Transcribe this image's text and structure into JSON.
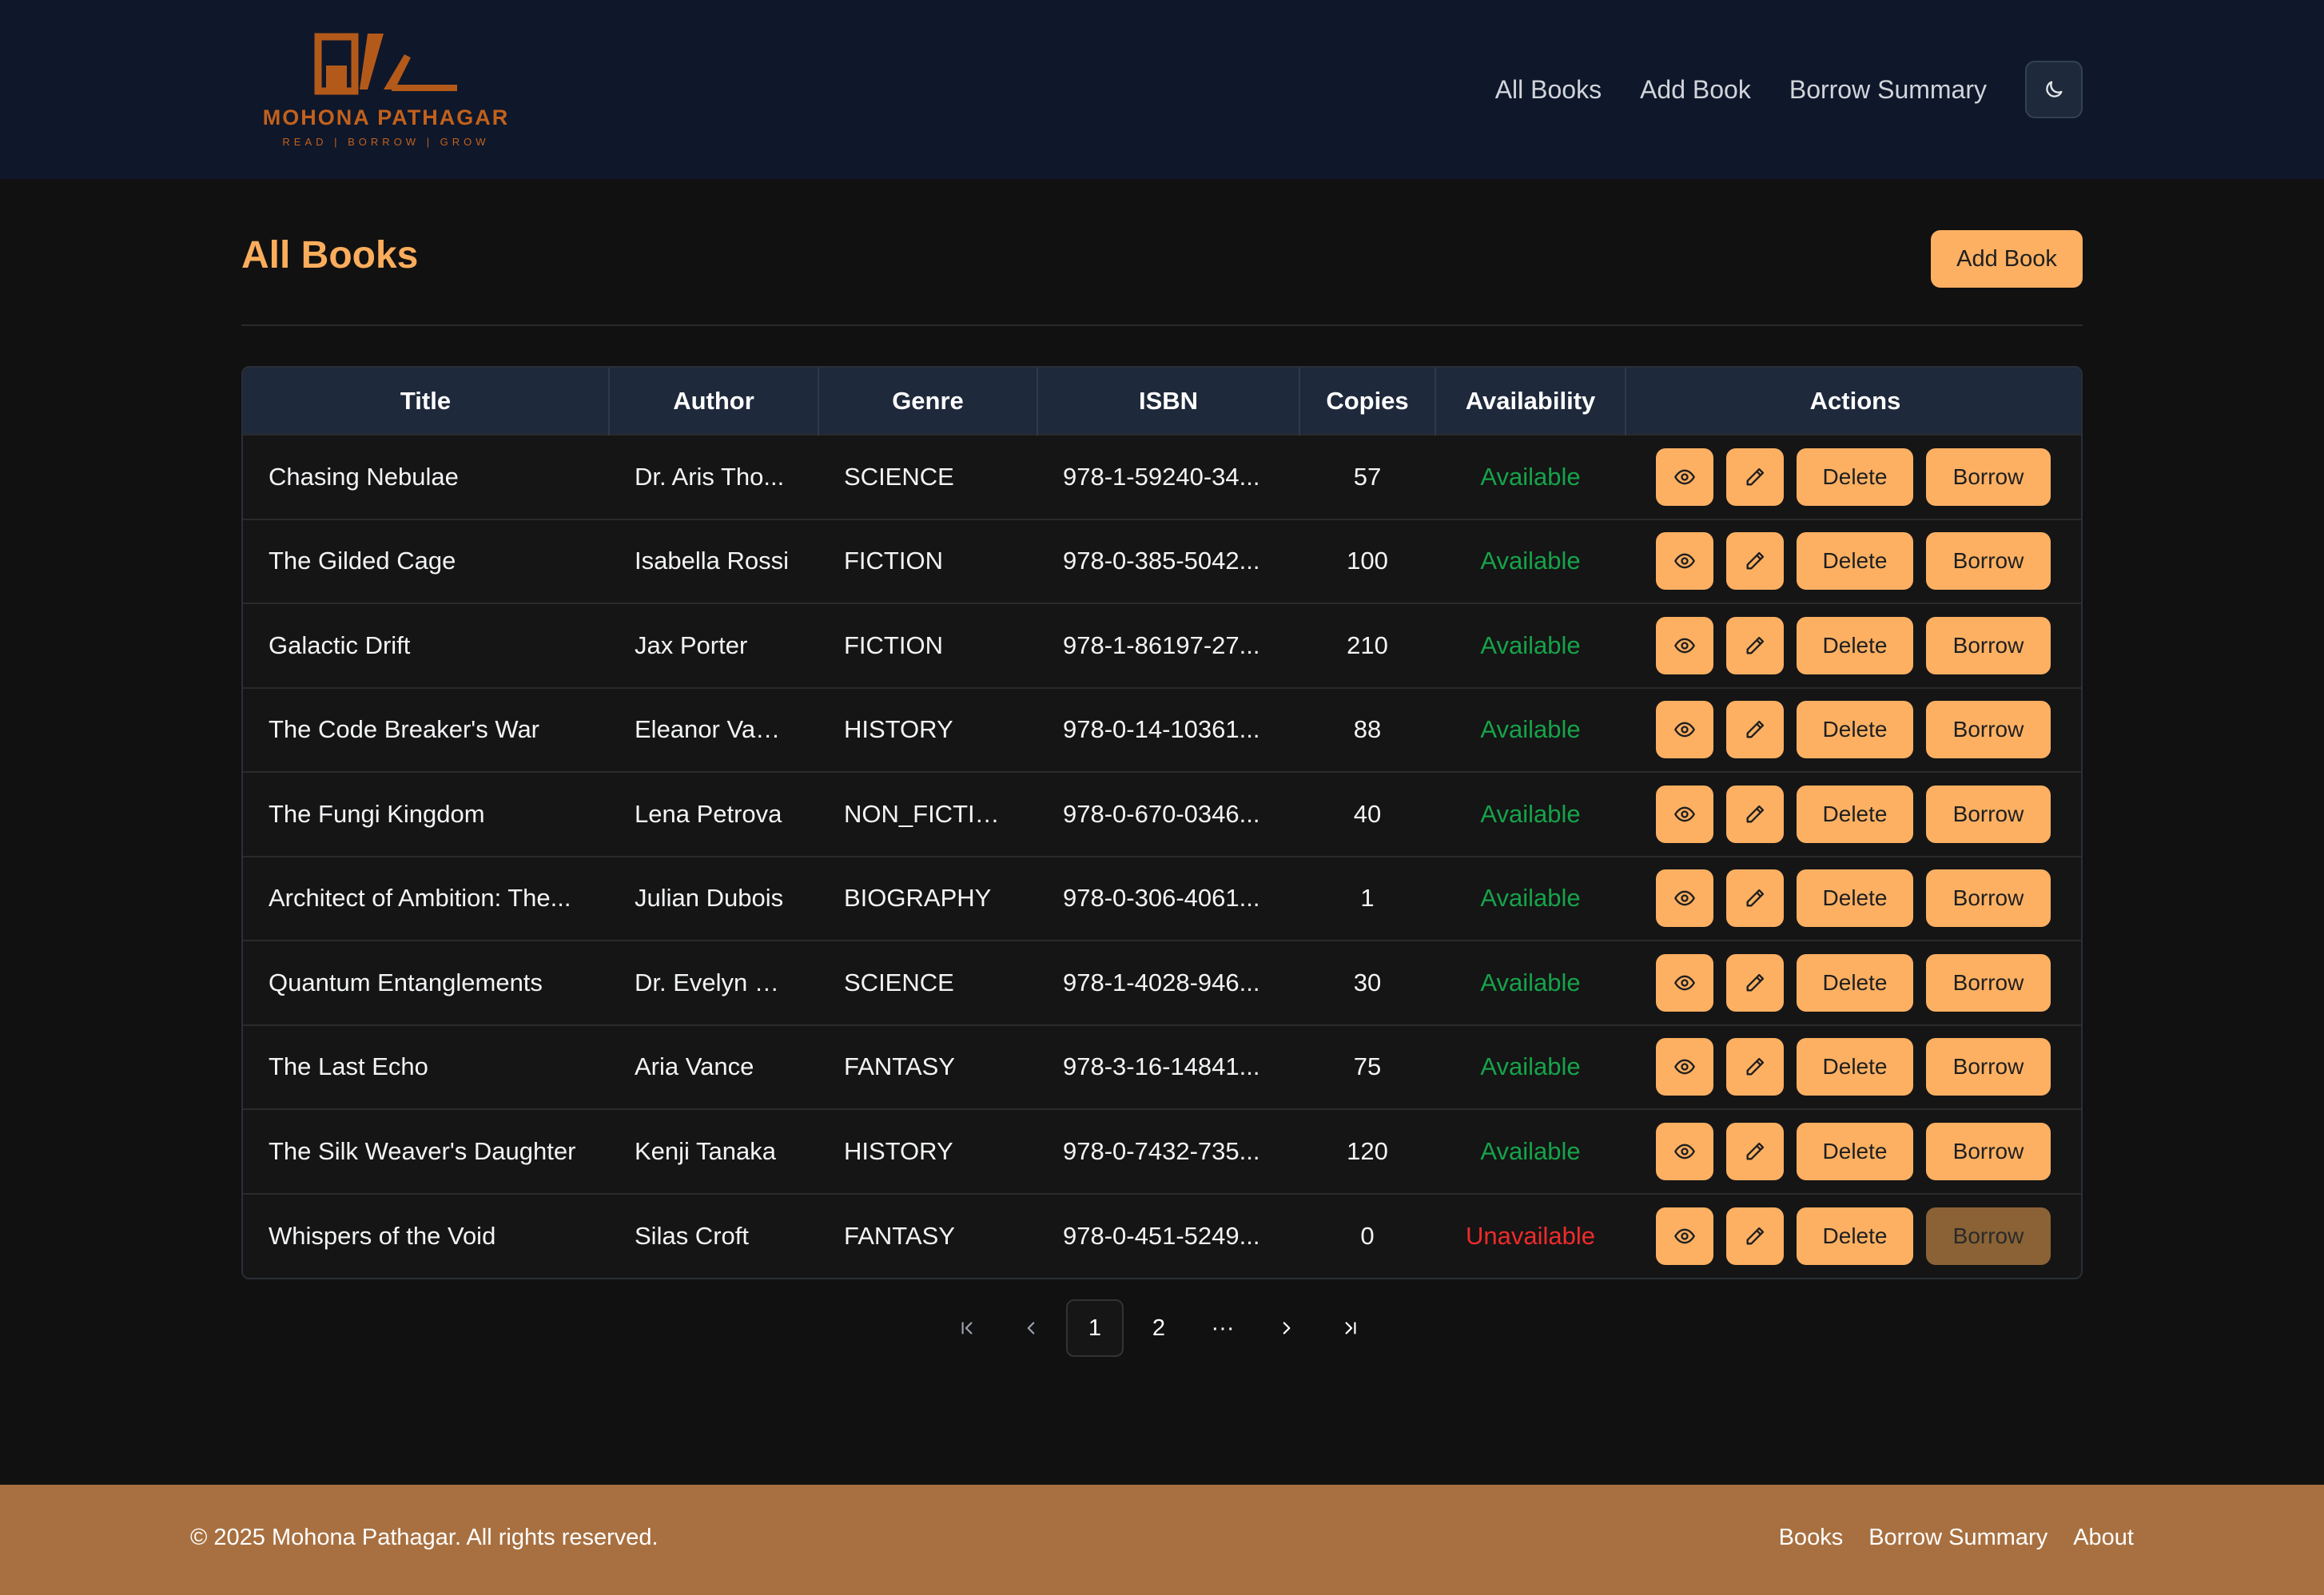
{
  "brand": {
    "name": "MOHONA PATHAGAR",
    "tagline": "READ | BORROW | GROW",
    "accent": "#c2611c"
  },
  "nav": {
    "items": [
      "All Books",
      "Add Book",
      "Borrow Summary"
    ],
    "theme_toggle_icon": "moon-icon"
  },
  "page": {
    "title": "All Books",
    "add_button": "Add Book"
  },
  "table": {
    "columns": [
      "Title",
      "Author",
      "Genre",
      "ISBN",
      "Copies",
      "Availability",
      "Actions"
    ],
    "rows": [
      {
        "title": "Chasing Nebulae",
        "author": "Dr. Aris Tho...",
        "genre": "SCIENCE",
        "isbn": "978-1-59240-34...",
        "copies": "57",
        "availability": "Available",
        "borrow_enabled": true
      },
      {
        "title": "The Gilded Cage",
        "author": "Isabella Rossi",
        "genre": "FICTION",
        "isbn": "978-0-385-5042...",
        "copies": "100",
        "availability": "Available",
        "borrow_enabled": true
      },
      {
        "title": "Galactic Drift",
        "author": "Jax Porter",
        "genre": "FICTION",
        "isbn": "978-1-86197-27...",
        "copies": "210",
        "availability": "Available",
        "borrow_enabled": true
      },
      {
        "title": "The Code Breaker's War",
        "author": "Eleanor Vance",
        "genre": "HISTORY",
        "isbn": "978-0-14-10361...",
        "copies": "88",
        "availability": "Available",
        "borrow_enabled": true
      },
      {
        "title": "The Fungi Kingdom",
        "author": "Lena Petrova",
        "genre": "NON_FICTION",
        "isbn": "978-0-670-0346...",
        "copies": "40",
        "availability": "Available",
        "borrow_enabled": true
      },
      {
        "title": "Architect of Ambition: The...",
        "author": "Julian Dubois",
        "genre": "BIOGRAPHY",
        "isbn": "978-0-306-4061...",
        "copies": "1",
        "availability": "Available",
        "borrow_enabled": true
      },
      {
        "title": "Quantum Entanglements",
        "author": "Dr. Evelyn R...",
        "genre": "SCIENCE",
        "isbn": "978-1-4028-946...",
        "copies": "30",
        "availability": "Available",
        "borrow_enabled": true
      },
      {
        "title": "The Last Echo",
        "author": "Aria Vance",
        "genre": "FANTASY",
        "isbn": "978-3-16-14841...",
        "copies": "75",
        "availability": "Available",
        "borrow_enabled": true
      },
      {
        "title": "The Silk Weaver's Daughter",
        "author": "Kenji Tanaka",
        "genre": "HISTORY",
        "isbn": "978-0-7432-735...",
        "copies": "120",
        "availability": "Available",
        "borrow_enabled": true
      },
      {
        "title": "Whispers of the Void",
        "author": "Silas Croft",
        "genre": "FANTASY",
        "isbn": "978-0-451-5249...",
        "copies": "0",
        "availability": "Unavailable",
        "borrow_enabled": false
      }
    ],
    "row_actions": {
      "view_icon": "eye-icon",
      "edit_icon": "pencil-icon",
      "delete_label": "Delete",
      "borrow_label": "Borrow"
    },
    "colors": {
      "available": "#16a34a",
      "unavailable": "#ef2b2b",
      "button": "#fdb062",
      "button_disabled": "#8a6235"
    }
  },
  "pagination": {
    "pages": [
      "1",
      "2"
    ],
    "ellipsis": "···",
    "current": "1"
  },
  "footer": {
    "copyright": "© 2025 Mohona Pathagar. All rights reserved.",
    "links": [
      "Books",
      "Borrow Summary",
      "About"
    ]
  }
}
